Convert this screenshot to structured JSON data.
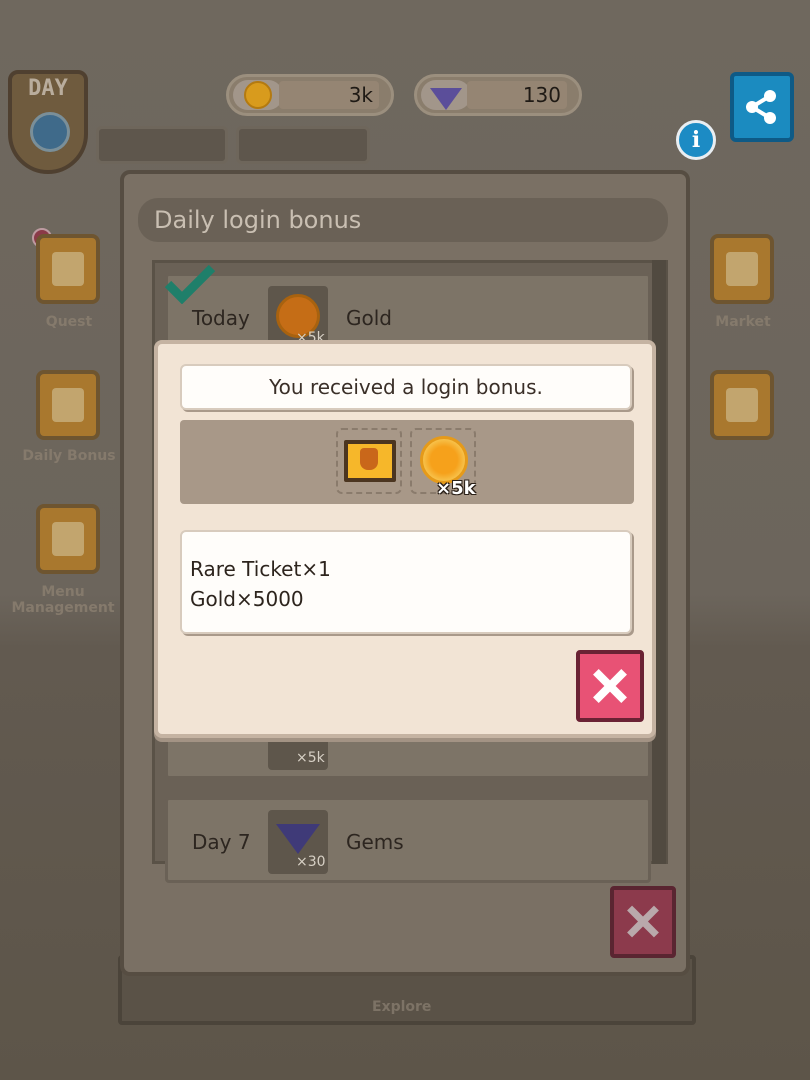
{
  "hud": {
    "coins": "3k",
    "gems": "130",
    "day_label": "DAY",
    "coin_icon": "gold-coin-icon",
    "gem_icon": "gem-icon"
  },
  "side_menu": {
    "left": [
      {
        "label": "Quest",
        "icon": "quest-icon"
      },
      {
        "label": "Daily Bonus",
        "icon": "calendar-icon"
      },
      {
        "label": "Menu Management",
        "icon": "dish-icon"
      }
    ],
    "right": [
      {
        "label": "Market",
        "icon": "bag-icon"
      },
      {
        "label": "",
        "icon": "banner-icon"
      }
    ]
  },
  "bottom_nav": {
    "explore_label": "Explore"
  },
  "login_panel": {
    "title": "Daily login bonus",
    "rows": [
      {
        "day": "Today",
        "reward": "Gold",
        "qty": "×5k",
        "claimed": true
      },
      {
        "day": "",
        "reward": "",
        "qty": "×5k",
        "claimed": false
      },
      {
        "day": "Day 7",
        "reward": "Gems",
        "qty": "×30",
        "claimed": false
      }
    ]
  },
  "dialog": {
    "message": "You received a login bonus.",
    "rewards": [
      {
        "icon": "rare-ticket-icon",
        "qty": ""
      },
      {
        "icon": "gold-coin-icon",
        "qty": "×5k"
      }
    ],
    "details": [
      "Rare Ticket×1",
      "Gold×5000"
    ]
  },
  "colors": {
    "accent_close": "#e85275",
    "share_blue": "#1b8bc0",
    "check_green": "#1f7f6a"
  }
}
